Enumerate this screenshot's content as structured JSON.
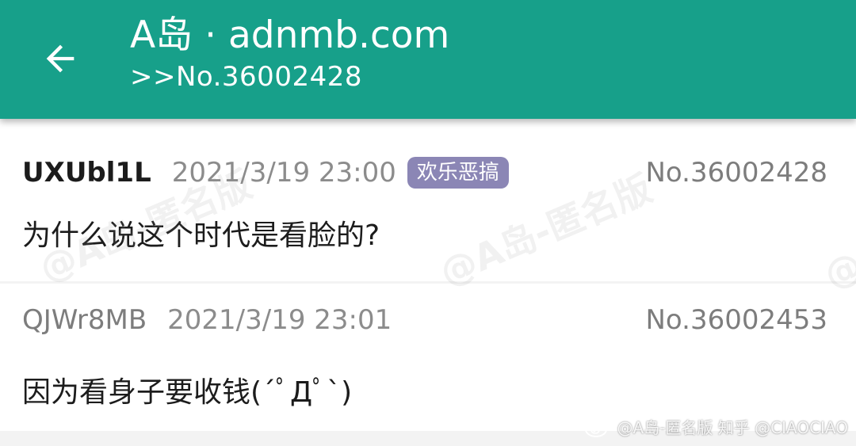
{
  "header": {
    "title": "A岛 · adnmb.com",
    "subtitle": ">>No.36002428",
    "back_icon": "arrow-left-icon",
    "color": "#17a08a"
  },
  "posts": [
    {
      "uid": "UXUbl1L",
      "time": "2021/3/19 23:00",
      "tag": "欢乐恶搞",
      "no": "No.36002428",
      "content": "为什么说这个时代是看脸的?"
    },
    {
      "uid": "QJWr8MB",
      "time": "2021/3/19 23:01",
      "no": "No.36002453",
      "content": "因为看身子要收钱(´ﾟДﾟ`)"
    }
  ],
  "watermark": {
    "text": "@A岛-匿名版"
  },
  "weibo_watermark": {
    "text": "@A岛-匿名版 知乎 @CIAOCIAO",
    "icon": "weibo-logo-icon"
  }
}
